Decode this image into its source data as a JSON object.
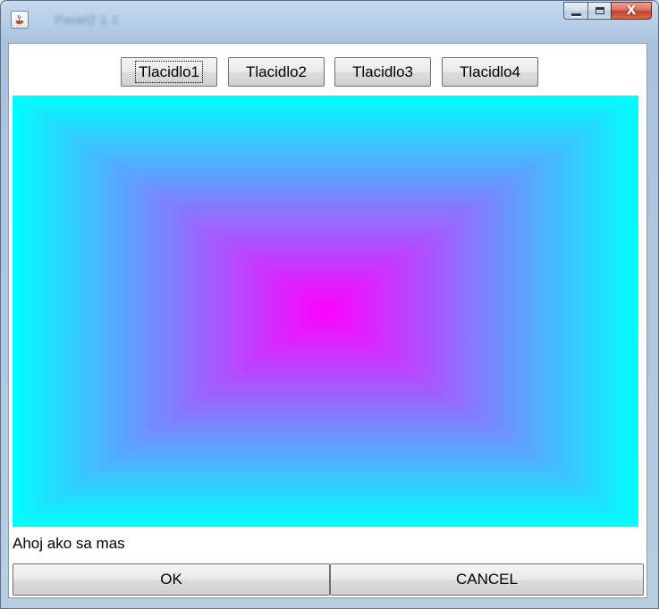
{
  "window": {
    "title": "Panel2 1.1",
    "icon": "java-cup-icon",
    "controls": [
      "minimize-icon",
      "maximize-icon",
      "close-icon"
    ],
    "close_glyph": "X"
  },
  "toolbar": {
    "buttons": [
      {
        "label": "Tlacidlo1",
        "focused": true
      },
      {
        "label": "Tlacidlo2",
        "focused": false
      },
      {
        "label": "Tlacidlo3",
        "focused": false
      },
      {
        "label": "Tlacidlo4",
        "focused": false
      }
    ]
  },
  "canvas": {
    "gradient_center_color": "#ff00ff",
    "gradient_edge_color": "#00ffff"
  },
  "status": {
    "text": "Ahoj ako sa mas"
  },
  "bottom_bar": {
    "ok_label": "OK",
    "cancel_label": "CANCEL"
  }
}
